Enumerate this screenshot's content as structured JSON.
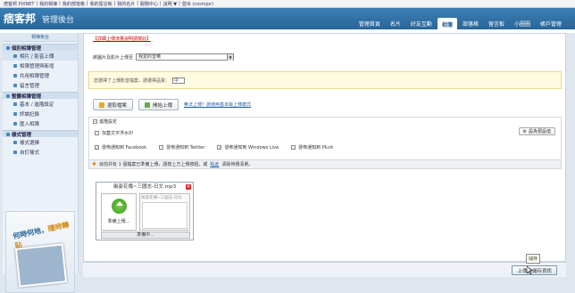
{
  "topbar": {
    "links": [
      "痞客邦 PIXNET",
      "|",
      "我的相簿",
      "|",
      "我的部落格",
      "|",
      "我的留言板",
      "|",
      "我的名片",
      "|",
      "服務中心",
      "|",
      "說明 ▼",
      "|",
      "登出 (cosmjor)"
    ]
  },
  "header": {
    "logo": "痞客邦",
    "subtitle": "管理後台",
    "tabs": [
      "管理首頁",
      "名片",
      "好友互動",
      "相簿",
      "部落格",
      "留言板",
      "小圈圈",
      "帳戶管理"
    ],
    "active_tab": "相簿"
  },
  "sidebar": {
    "title": "相簿後台",
    "groups": [
      {
        "head": "個別相簿管理",
        "items": [
          "相片 / 影音上傳",
          "相簿管理與新增",
          "共用相簿管理",
          "留言管理"
        ]
      },
      {
        "head": "整體相簿管理",
        "items": [
          "基本 / 進階設定",
          "評論記錄",
          "匯入相簿"
        ]
      },
      {
        "head": "樣式管理",
        "items": [
          "樣式選擇",
          "自訂樣式"
        ]
      }
    ],
    "ad": {
      "line1": "何時何地，",
      "line2": "隨時轉貼"
    }
  },
  "main": {
    "notice": "【詳細上傳流量說明請按此】",
    "upload_to_label": "將圖片及影片上傳至",
    "album_selected": "我愛的音樂",
    "yellow_text": "您選擇了上傳影音檔案，請選擇品質：",
    "quality_selected": "中",
    "pick_files": "選取檔案",
    "start_upload": "開始上傳",
    "fallback_link": "無法上傳？請使用基本版上傳模式",
    "advanced_title": "進階設定",
    "watermark_label": "加蓋文字浮水印",
    "set_default": "設為預設值",
    "shares": [
      {
        "label": "發佈通知到 Facebook",
        "checked": true
      },
      {
        "label": "發佈通知到 Twitter",
        "checked": false
      },
      {
        "label": "發佈通知到 Windows Live",
        "checked": true
      },
      {
        "label": "發佈通知到 Plurk",
        "checked": false
      }
    ],
    "status_prefix": "目前共有 1 個檔案已準備上傳，請按上方上傳按鈕，或",
    "status_link": "點此",
    "status_suffix": "清除待傳清單。",
    "file_card": {
      "filename": "風姿花傳~三國志-日文.mp3",
      "ready_label": "準備上傳...",
      "desc_placeholder": "風姿花傳~三國志-日文",
      "progress_text": "準備中..."
    },
    "save_button": "上傳並儲存資訊",
    "tooltip": "儲存"
  }
}
